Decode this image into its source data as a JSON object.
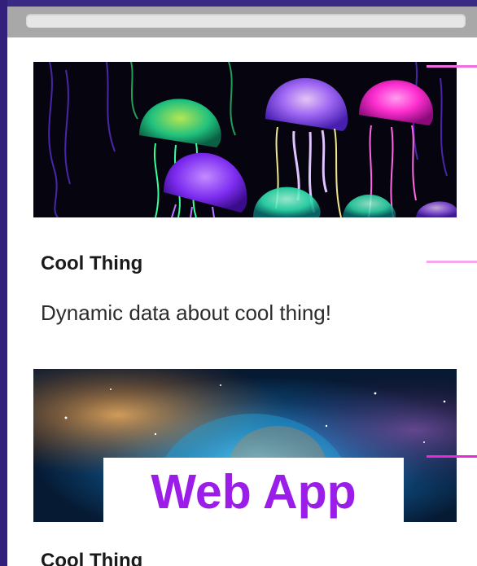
{
  "cards": [
    {
      "title": "Cool Thing",
      "description": "Dynamic data about cool thing!",
      "image": "jellyfish-photo"
    },
    {
      "title": "Cool Thing",
      "overlay_label": "Web App",
      "image": "nebula-photo"
    }
  ],
  "colors": {
    "page_background": "#2c1a6b",
    "browser_bar": "#a8a8a8",
    "overlay_text": "#9b1de8",
    "accent": "#f06ee0"
  }
}
